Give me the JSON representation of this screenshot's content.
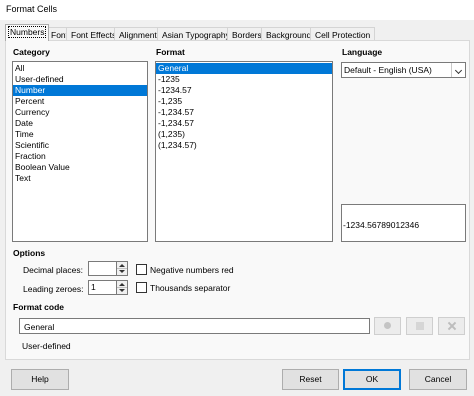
{
  "window": {
    "title": "Format Cells"
  },
  "tabs": [
    "Numbers",
    "Font",
    "Font Effects",
    "Alignment",
    "Asian Typography",
    "Borders",
    "Background",
    "Cell Protection"
  ],
  "category": {
    "heading": "Category",
    "items": [
      "All",
      "User-defined",
      "Number",
      "Percent",
      "Currency",
      "Date",
      "Time",
      "Scientific",
      "Fraction",
      "Boolean Value",
      "Text"
    ],
    "selected": "Number"
  },
  "format": {
    "heading": "Format",
    "items": [
      "General",
      "-1235",
      "-1234.57",
      "-1,235",
      "-1,234.57",
      "-1,234.57",
      "(1,235)",
      "(1,234.57)"
    ],
    "selected": "General"
  },
  "language": {
    "heading": "Language",
    "value": "Default - English (USA)"
  },
  "preview": {
    "text": "-1234.56789012346"
  },
  "options": {
    "heading": "Options",
    "decimal_places_label": "Decimal places:",
    "decimal_places_value": "",
    "leading_zeroes_label": "Leading zeroes:",
    "leading_zeroes_value": "1",
    "negative_red_label": "Negative numbers red",
    "negative_red_checked": false,
    "thousands_label": "Thousands separator",
    "thousands_checked": false
  },
  "format_code": {
    "heading": "Format code",
    "value": "General",
    "status": "User-defined"
  },
  "buttons": {
    "help": "Help",
    "reset": "Reset",
    "ok": "OK",
    "cancel": "Cancel"
  },
  "icons": {
    "add": "add-format-icon",
    "edit": "edit-comment-icon",
    "delete": "delete-format-icon"
  },
  "colors": {
    "selection": "#0078d7",
    "dialog_bg": "#f0f0f0",
    "panel_bg": "#f9f9f9"
  }
}
